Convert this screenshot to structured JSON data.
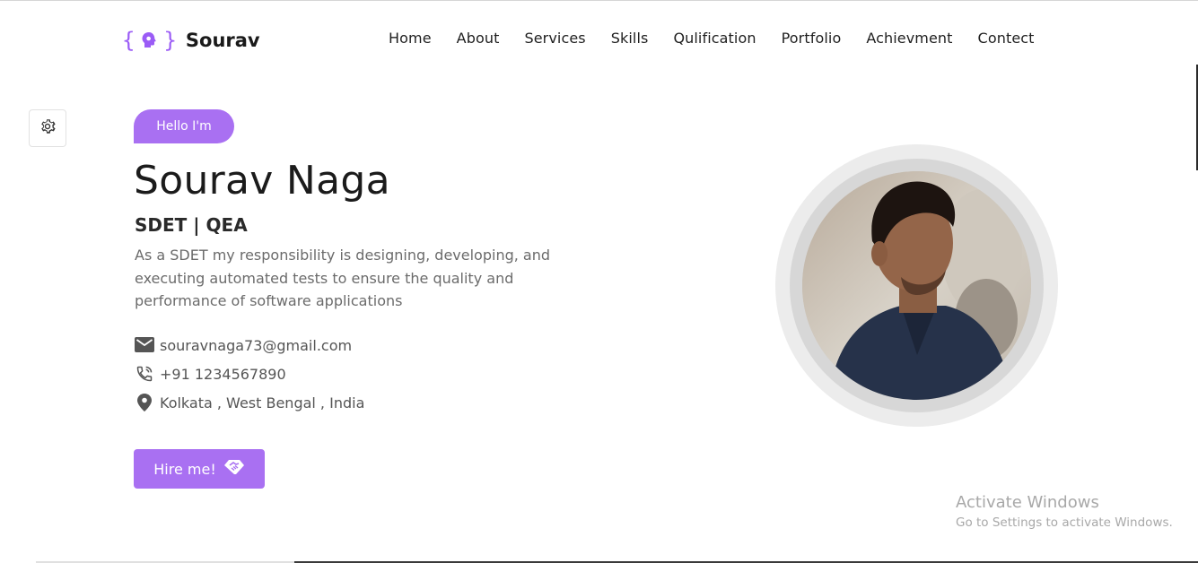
{
  "brand": {
    "name": "Sourav",
    "accent_color": "#a970f2"
  },
  "nav": {
    "items": [
      "Home",
      "About",
      "Services",
      "Skills",
      "Qulification",
      "Portfolio",
      "Achievment",
      "Contect"
    ]
  },
  "settings": {
    "icon": "gear-icon"
  },
  "hero": {
    "badge": "Hello I'm",
    "name": "Sourav Naga",
    "role": "SDET | QEA",
    "description": "As a SDET my responsibility is designing, developing, and executing automated tests to ensure the quality and performance of software applications",
    "contacts": [
      {
        "icon": "mail-icon",
        "text": "souravnaga73@gmail.com"
      },
      {
        "icon": "phone-icon",
        "text": "+91 1234567890"
      },
      {
        "icon": "location-pin-icon",
        "text": "Kolkata , West Bengal , India"
      }
    ],
    "hire_button": "Hire me!",
    "hire_icon": "handshake-icon"
  },
  "profile_photo": {
    "icon": "avatar"
  },
  "watermark": {
    "title": "Activate Windows",
    "subtitle": "Go to Settings to activate Windows."
  }
}
